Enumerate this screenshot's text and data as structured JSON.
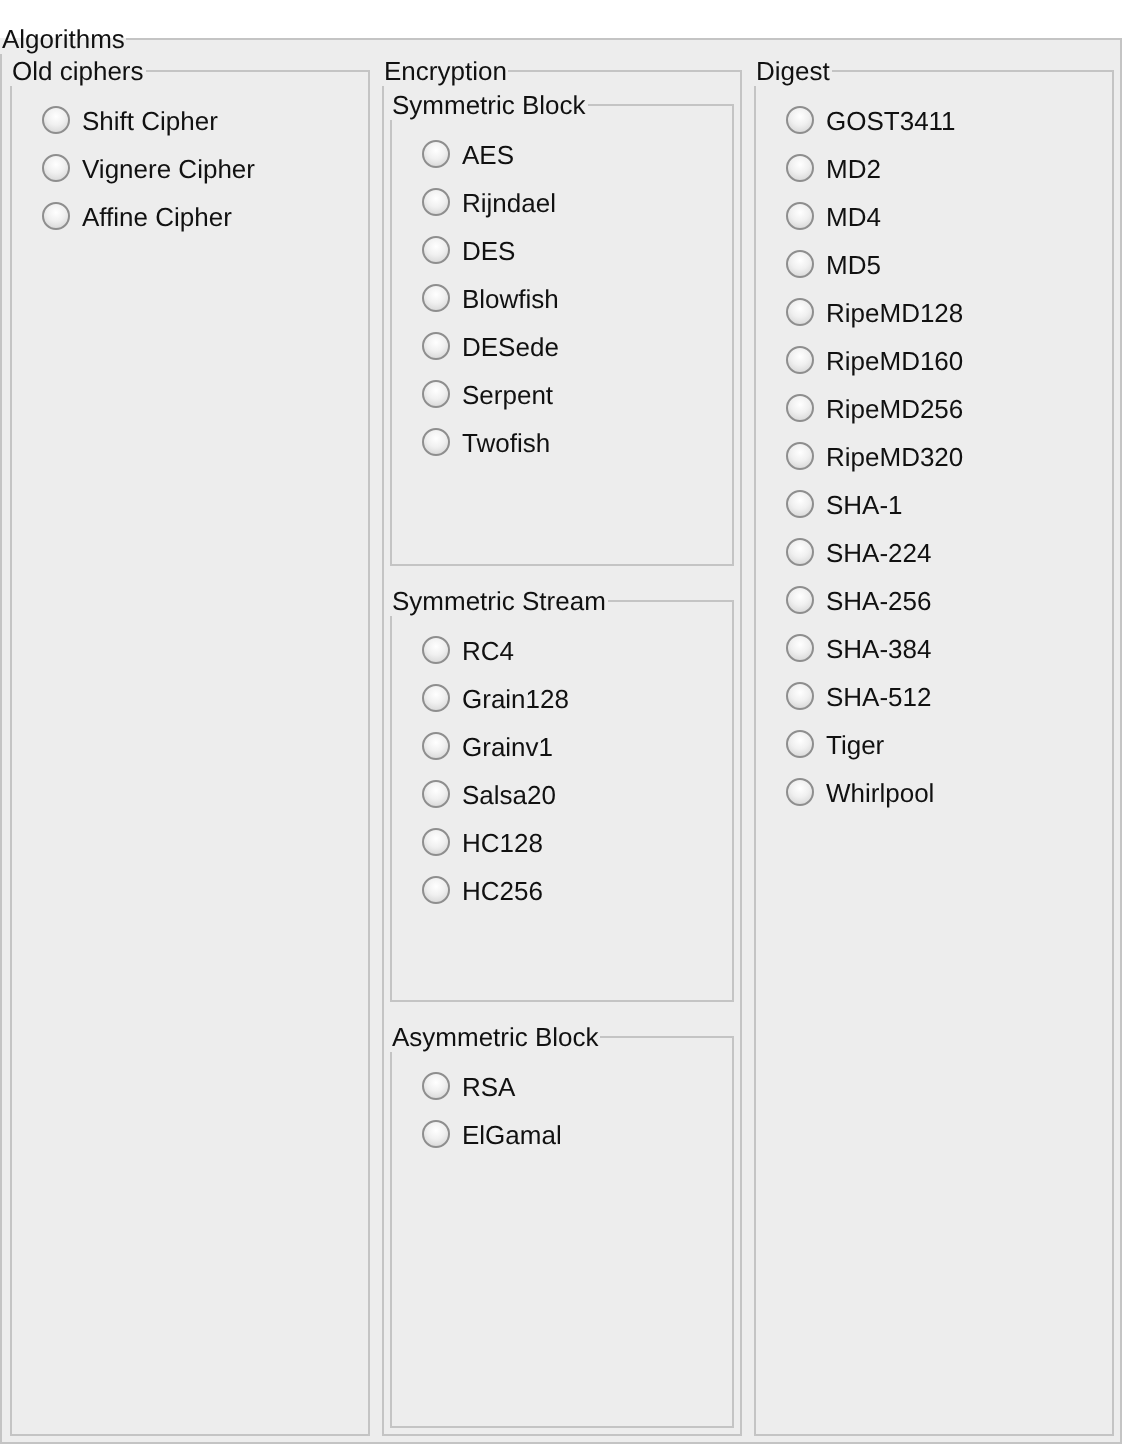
{
  "title": "Algorithms",
  "columns": [
    {
      "title": "Old ciphers",
      "options": [
        {
          "label": "Shift Cipher",
          "selected": false
        },
        {
          "label": "Vignere Cipher",
          "selected": false
        },
        {
          "label": "Affine Cipher",
          "selected": false
        }
      ]
    },
    {
      "title": "Encryption",
      "groups": [
        {
          "title": "Symmetric Block",
          "options": [
            {
              "label": "AES",
              "selected": false
            },
            {
              "label": "Rijndael",
              "selected": false
            },
            {
              "label": "DES",
              "selected": false
            },
            {
              "label": "Blowfish",
              "selected": false
            },
            {
              "label": "DESede",
              "selected": false
            },
            {
              "label": "Serpent",
              "selected": false
            },
            {
              "label": "Twofish",
              "selected": false
            }
          ]
        },
        {
          "title": "Symmetric Stream",
          "options": [
            {
              "label": "RC4",
              "selected": false
            },
            {
              "label": "Grain128",
              "selected": false
            },
            {
              "label": "Grainv1",
              "selected": false
            },
            {
              "label": "Salsa20",
              "selected": false
            },
            {
              "label": "HC128",
              "selected": false
            },
            {
              "label": "HC256",
              "selected": false
            }
          ]
        },
        {
          "title": "Asymmetric Block",
          "options": [
            {
              "label": "RSA",
              "selected": false
            },
            {
              "label": "ElGamal",
              "selected": false
            }
          ]
        }
      ]
    },
    {
      "title": "Digest",
      "options": [
        {
          "label": "GOST3411",
          "selected": false
        },
        {
          "label": "MD2",
          "selected": false
        },
        {
          "label": "MD4",
          "selected": false
        },
        {
          "label": "MD5",
          "selected": false
        },
        {
          "label": "RipeMD128",
          "selected": false
        },
        {
          "label": "RipeMD160",
          "selected": false
        },
        {
          "label": "RipeMD256",
          "selected": false
        },
        {
          "label": "RipeMD320",
          "selected": false
        },
        {
          "label": "SHA-1",
          "selected": false
        },
        {
          "label": "SHA-224",
          "selected": false
        },
        {
          "label": "SHA-256",
          "selected": false
        },
        {
          "label": "SHA-384",
          "selected": false
        },
        {
          "label": "SHA-512",
          "selected": false
        },
        {
          "label": "Tiger",
          "selected": false
        },
        {
          "label": "Whirlpool",
          "selected": false
        }
      ]
    }
  ]
}
